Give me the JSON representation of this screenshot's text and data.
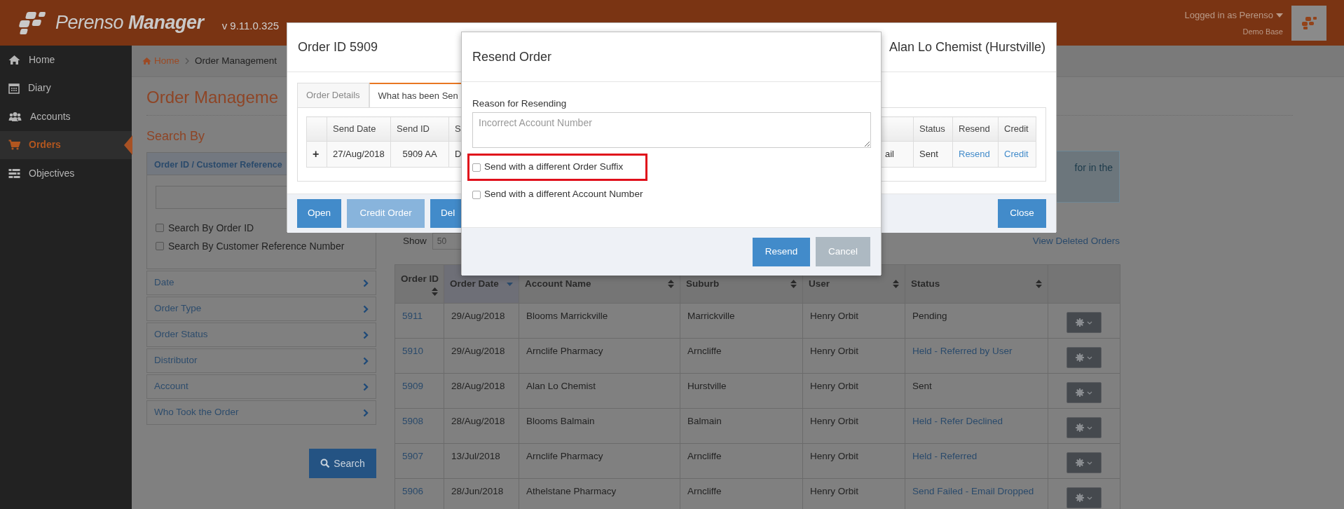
{
  "header": {
    "logo_light": "Perenso",
    "logo_bold": "Manager",
    "version": "v 9.11.0.325",
    "user": "Logged in as Perenso",
    "database": "Demo Base"
  },
  "sidebar": {
    "items": [
      {
        "label": "Home",
        "kind": "home",
        "selected": false
      },
      {
        "label": "Diary",
        "kind": "diary",
        "selected": false
      },
      {
        "label": "Accounts",
        "kind": "accounts",
        "selected": false
      },
      {
        "label": "Orders",
        "kind": "orders",
        "selected": true
      },
      {
        "label": "Objectives",
        "kind": "objectives",
        "selected": false
      }
    ]
  },
  "breadcrumb": [
    {
      "label": "Home"
    },
    {
      "label": "Order Management"
    }
  ],
  "page_title": "Order Manageme",
  "search_panel": {
    "heading": "Search By",
    "section_title": "Order ID / Customer Reference",
    "checkboxes": [
      {
        "label": "Search By Order ID",
        "checked": false
      },
      {
        "label": "Search By Customer Reference Number",
        "checked": false
      }
    ],
    "filters": [
      "Date",
      "Order Type",
      "Order Status",
      "Distributor",
      "Account",
      "Who Took the Order"
    ],
    "search_button": "Search"
  },
  "notice": {
    "text": "for in the"
  },
  "list_controls": {
    "show_label": "Show",
    "page_size": "50",
    "deleted_link": "View Deleted Orders"
  },
  "orders_table": {
    "columns": [
      {
        "label": "Order ID",
        "sorted": false
      },
      {
        "label": "Order Date",
        "sorted": true
      },
      {
        "label": "Account Name",
        "sorted": false
      },
      {
        "label": "Suburb",
        "sorted": false
      },
      {
        "label": "User",
        "sorted": false
      },
      {
        "label": "Status",
        "sorted": false
      }
    ],
    "rows": [
      {
        "order_id": "5911",
        "order_date": "29/Aug/2018",
        "account_name": "Blooms Marrickville",
        "suburb": "Marrickville",
        "user": "Henry Orbit",
        "status": "Pending",
        "status_link": false
      },
      {
        "order_id": "5910",
        "order_date": "29/Aug/2018",
        "account_name": "Arnclife Pharmacy",
        "suburb": "Arncliffe",
        "user": "Henry Orbit",
        "status": "Held - Referred by User",
        "status_link": true
      },
      {
        "order_id": "5909",
        "order_date": "28/Aug/2018",
        "account_name": "Alan Lo Chemist",
        "suburb": "Hurstville",
        "user": "Henry Orbit",
        "status": "Sent",
        "status_link": false
      },
      {
        "order_id": "5908",
        "order_date": "28/Aug/2018",
        "account_name": "Blooms Balmain",
        "suburb": "Balmain",
        "user": "Henry Orbit",
        "status": "Held - Refer Declined",
        "status_link": true
      },
      {
        "order_id": "5907",
        "order_date": "13/Jul/2018",
        "account_name": "Arnclife Pharmacy",
        "suburb": "Arncliffe",
        "user": "Henry Orbit",
        "status": "Held - Referred",
        "status_link": true
      },
      {
        "order_id": "5906",
        "order_date": "28/Jun/2018",
        "account_name": "Athelstane Pharmacy",
        "suburb": "Arncliffe",
        "user": "Henry Orbit",
        "status": "Send Failed - Email Dropped",
        "status_link": true
      }
    ]
  },
  "order_modal": {
    "title": "Order ID 5909",
    "customer": "Alan Lo Chemist (Hurstville)",
    "tabs": [
      {
        "label": "Order Details",
        "selected": false
      },
      {
        "label": "What has been Sen",
        "selected": true
      }
    ],
    "table": {
      "columns": [
        {
          "kind": "text",
          "label": "Send Date"
        },
        {
          "kind": "text",
          "label": "Send ID"
        },
        {
          "kind": "text",
          "label": "S"
        },
        {
          "kind": "covered"
        },
        {
          "kind": "covered"
        },
        {
          "kind": "text",
          "label": "Status"
        },
        {
          "kind": "text",
          "label": "Resend"
        },
        {
          "kind": "text",
          "label": "Credit"
        }
      ],
      "row": {
        "expand": "+",
        "cells": [
          {
            "text": "27/Aug/2018",
            "kind": "text"
          },
          {
            "text": "5909  AA",
            "kind": "text"
          },
          {
            "text": "D",
            "kind": "text"
          },
          {
            "kind": "covered"
          },
          {
            "text": "ail",
            "kind": "text"
          },
          {
            "text": "Sent",
            "kind": "text"
          },
          {
            "text": "Resend",
            "kind": "link"
          },
          {
            "text": "Credit",
            "kind": "link"
          }
        ]
      }
    },
    "buttons": [
      {
        "label": "Open",
        "disabled": false
      },
      {
        "label": "Credit Order",
        "disabled": true
      },
      {
        "label": "Del",
        "disabled": false
      }
    ],
    "close_button": "Close"
  },
  "resend_modal": {
    "title": "Resend Order",
    "reason_label": "Reason for Resending",
    "reason": {
      "placeholder": "Incorrect Account Number"
    },
    "options": [
      {
        "label": "Send with a different Order Suffix",
        "checked": false,
        "highlighted": true
      },
      {
        "label": "Send with a different Account Number",
        "checked": false,
        "highlighted": false
      }
    ],
    "buttons": [
      {
        "label": "Resend",
        "kind": "primary"
      },
      {
        "label": "Cancel",
        "kind": "secondary"
      }
    ]
  }
}
